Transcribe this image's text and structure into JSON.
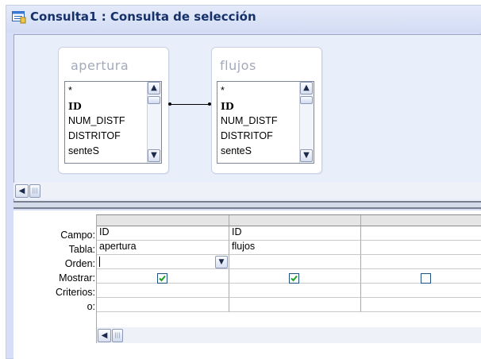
{
  "window": {
    "title": "Consulta1 : Consulta de selección",
    "icon": "query-design-icon"
  },
  "tables": [
    {
      "name": "apertura",
      "fields": [
        "*",
        "ID",
        "NUM_DISTF",
        "DISTRITOF",
        "senteS"
      ],
      "key_field_index": 1
    },
    {
      "name": "flujos",
      "fields": [
        "*",
        "ID",
        "NUM_DISTF",
        "DISTRITOF",
        "senteS"
      ],
      "key_field_index": 1
    }
  ],
  "relationship": {
    "from": "apertura.ID",
    "to": "flujos.ID"
  },
  "grid": {
    "row_labels": [
      "Campo:",
      "Tabla:",
      "Orden:",
      "Mostrar:",
      "Criterios:",
      "o:"
    ],
    "columns": [
      {
        "campo": "ID",
        "tabla": "apertura",
        "orden": "",
        "mostrar": true,
        "criterios": "",
        "o": ""
      },
      {
        "campo": "ID",
        "tabla": "flujos",
        "orden": "",
        "mostrar": true,
        "criterios": "",
        "o": ""
      },
      {
        "campo": "",
        "tabla": "",
        "orden": "",
        "mostrar": false,
        "criterios": "",
        "o": ""
      }
    ]
  },
  "colors": {
    "frame": "#d6dff7",
    "title_text": "#16306a",
    "checkbox_border": "#1c5180",
    "checkmark": "#1fa21f"
  }
}
